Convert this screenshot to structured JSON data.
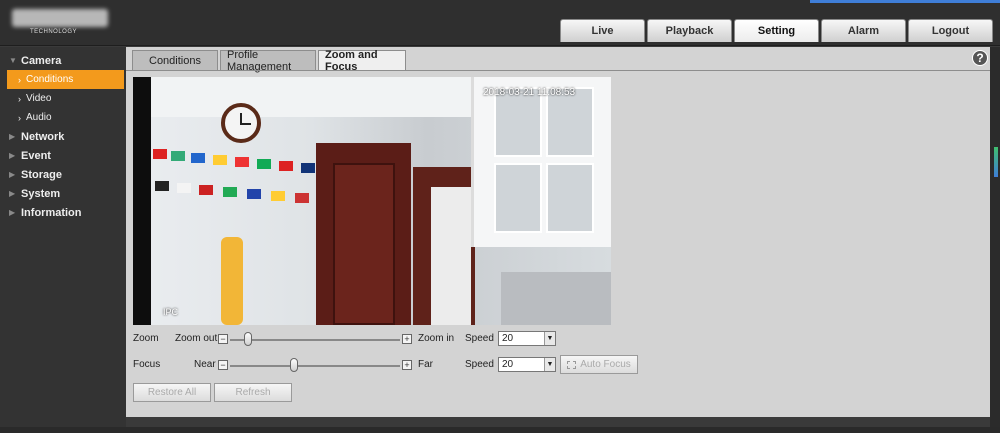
{
  "header": {
    "logo_subtext": "TECHNOLOGY",
    "tabs": [
      "Live",
      "Playback",
      "Setting",
      "Alarm",
      "Logout"
    ],
    "active_tab": "Setting"
  },
  "sidebar": {
    "groups": [
      {
        "label": "Camera",
        "expanded": true,
        "children": [
          "Conditions",
          "Video",
          "Audio"
        ],
        "active_child": "Conditions"
      },
      {
        "label": "Network"
      },
      {
        "label": "Event"
      },
      {
        "label": "Storage"
      },
      {
        "label": "System"
      },
      {
        "label": "Information"
      }
    ]
  },
  "content": {
    "help_label": "?",
    "subtabs": [
      "Conditions",
      "Profile Management",
      "Zoom and Focus"
    ],
    "active_subtab": "Zoom and Focus",
    "video": {
      "timestamp": "2018-03-21 11:08:53",
      "channel_label": "IPC"
    },
    "zoom": {
      "label": "Zoom",
      "left_label": "Zoom out",
      "right_label": "Zoom in",
      "minus": "−",
      "plus": "+",
      "speed_label": "Speed",
      "speed_value": "20",
      "level_fraction": 0.08
    },
    "focus": {
      "label": "Focus",
      "left_label": "Near",
      "right_label": "Far",
      "minus": "−",
      "plus": "+",
      "speed_label": "Speed",
      "speed_value": "20",
      "auto_focus_label": "Auto Focus",
      "level_fraction": 0.35
    },
    "buttons": {
      "restore_all": "Restore All",
      "refresh": "Refresh"
    }
  },
  "colors": {
    "accent_active": "#f39a1c",
    "top_highlight": "#3f7ed8",
    "panel_bg": "#d3d3d3",
    "sidebar_bg": "#333333"
  }
}
